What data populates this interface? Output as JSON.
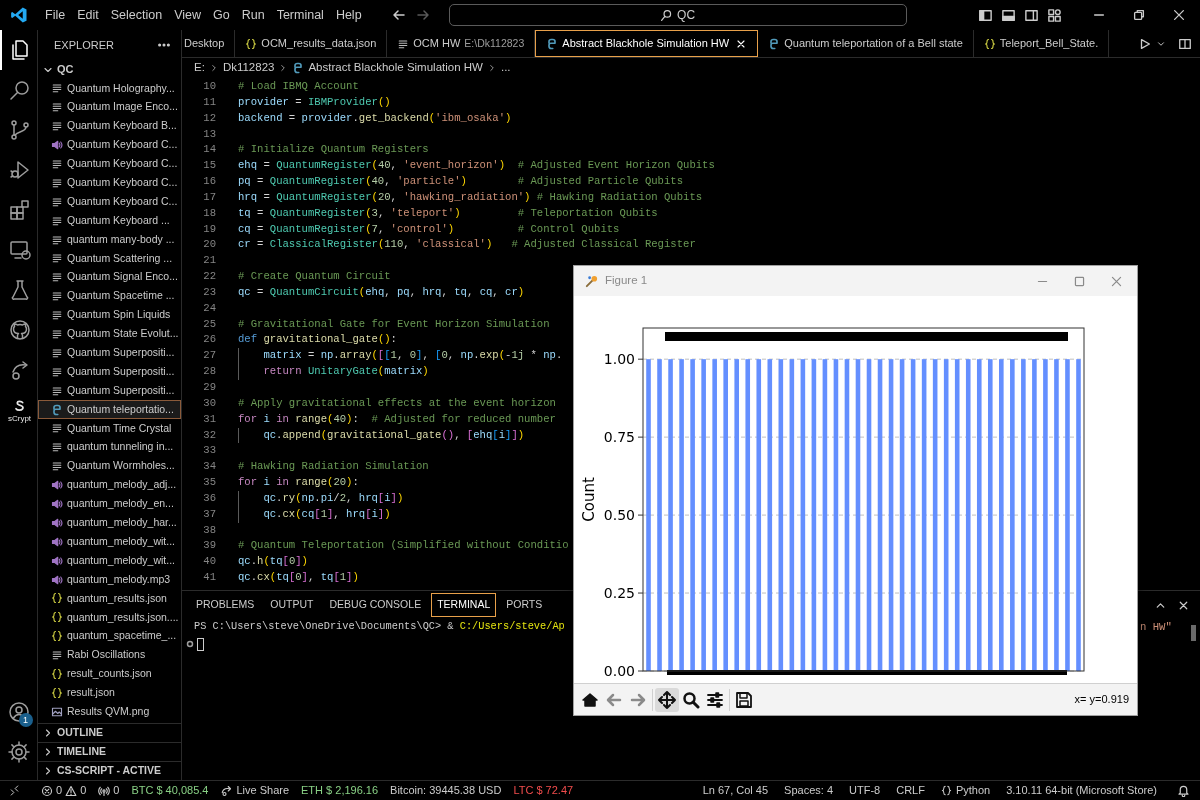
{
  "title_bar": {
    "menu": [
      "File",
      "Edit",
      "Selection",
      "View",
      "Go",
      "Run",
      "Terminal",
      "Help"
    ],
    "nav": [
      {
        "kind": "back",
        "disabled": false
      },
      {
        "kind": "forward",
        "disabled": true
      }
    ],
    "search": {
      "value": "QC"
    }
  },
  "activity_bar": {
    "items": [
      {
        "kind": "files",
        "selected": true
      },
      {
        "kind": "search",
        "selected": false
      },
      {
        "kind": "scm",
        "selected": false
      },
      {
        "kind": "debug",
        "selected": false
      },
      {
        "kind": "extensions",
        "selected": false
      },
      {
        "kind": "remote",
        "selected": false
      },
      {
        "kind": "testing",
        "selected": false
      },
      {
        "kind": "github",
        "selected": false
      },
      {
        "kind": "liveshare",
        "selected": false
      },
      {
        "kind": "scrypt",
        "selected": false,
        "label": "sCrypt"
      }
    ],
    "bottom": [
      {
        "kind": "account",
        "badge": "1"
      },
      {
        "kind": "settings"
      }
    ]
  },
  "explorer": {
    "title": "EXPLORER",
    "folder": {
      "name": "QC",
      "expanded": true
    },
    "items": [
      {
        "name": "Quantum Holography...",
        "kind": "md",
        "selected": false
      },
      {
        "name": "Quantum Image Enco...",
        "kind": "md",
        "selected": false
      },
      {
        "name": "Quantum Keyboard B...",
        "kind": "md",
        "selected": false
      },
      {
        "name": "Quantum Keyboard C...",
        "kind": "audio",
        "selected": false
      },
      {
        "name": "Quantum Keyboard C...",
        "kind": "md",
        "selected": false
      },
      {
        "name": "Quantum Keyboard C...",
        "kind": "md",
        "selected": false
      },
      {
        "name": "Quantum Keyboard C...",
        "kind": "md",
        "selected": false
      },
      {
        "name": "Quantum Keyboard ...",
        "kind": "md",
        "selected": false
      },
      {
        "name": "quantum many-body ...",
        "kind": "md",
        "selected": false
      },
      {
        "name": "Quantum Scattering ...",
        "kind": "md",
        "selected": false
      },
      {
        "name": "Quantum Signal Enco...",
        "kind": "md",
        "selected": false
      },
      {
        "name": "Quantum Spacetime ...",
        "kind": "md",
        "selected": false
      },
      {
        "name": "Quantum Spin Liquids",
        "kind": "md",
        "selected": false
      },
      {
        "name": "Quantum State Evolut...",
        "kind": "md",
        "selected": false
      },
      {
        "name": "Quantum Superpositi...",
        "kind": "md",
        "selected": false
      },
      {
        "name": "Quantum Superpositi...",
        "kind": "md",
        "selected": false
      },
      {
        "name": "Quantum Superpositi...",
        "kind": "md",
        "selected": false
      },
      {
        "name": "Quantum teleportatio...",
        "kind": "py",
        "selected": true
      },
      {
        "name": "Quantum Time Crystal",
        "kind": "md",
        "selected": false
      },
      {
        "name": "quantum tunneling in...",
        "kind": "md",
        "selected": false
      },
      {
        "name": "Quantum Wormholes...",
        "kind": "md",
        "selected": false
      },
      {
        "name": "quantum_melody_adj...",
        "kind": "audio",
        "selected": false
      },
      {
        "name": "quantum_melody_en...",
        "kind": "audio",
        "selected": false
      },
      {
        "name": "quantum_melody_har...",
        "kind": "audio",
        "selected": false
      },
      {
        "name": "quantum_melody_wit...",
        "kind": "audio",
        "selected": false
      },
      {
        "name": "quantum_melody_wit...",
        "kind": "audio",
        "selected": false
      },
      {
        "name": "quantum_melody.mp3",
        "kind": "audio",
        "selected": false
      },
      {
        "name": "quantum_results.json",
        "kind": "json",
        "selected": false
      },
      {
        "name": "quantum_results.json....",
        "kind": "json",
        "selected": false
      },
      {
        "name": "quantum_spacetime_...",
        "kind": "json",
        "selected": false
      },
      {
        "name": "Rabi Oscillations",
        "kind": "md",
        "selected": false
      },
      {
        "name": "result_counts.json",
        "kind": "json",
        "selected": false
      },
      {
        "name": "result.json",
        "kind": "json",
        "selected": false
      },
      {
        "name": "Results QVM.png",
        "kind": "image",
        "selected": false
      }
    ],
    "sections": [
      {
        "name": "OUTLINE",
        "expanded": false
      },
      {
        "name": "TIMELINE",
        "expanded": false
      },
      {
        "name": "CS-SCRIPT - ACTIVE",
        "expanded": false
      }
    ]
  },
  "editor": {
    "tabs": [
      {
        "label": "Desktop",
        "kind": "none",
        "selected": false
      },
      {
        "label": "OCM_results_data.json",
        "kind": "json",
        "selected": false
      },
      {
        "label": "OCM HW",
        "detail": "E:\\Dk112823",
        "kind": "md",
        "selected": false
      },
      {
        "label": "Abstract Blackhole Simulation HW",
        "kind": "py",
        "selected": true
      },
      {
        "label": "Quantum teleportation of a Bell state",
        "kind": "py",
        "selected": false
      },
      {
        "label": "Teleport_Bell_State.",
        "kind": "json",
        "selected": false
      }
    ],
    "breadcrumb": [
      {
        "label": "E:",
        "kind": "none"
      },
      {
        "label": "Dk112823",
        "kind": "none"
      },
      {
        "label": "Abstract Blackhole Simulation HW",
        "kind": "py"
      },
      {
        "label": "...",
        "kind": "none"
      }
    ],
    "lines": [
      {
        "n": "10",
        "tokens": [
          {
            "kind": "c",
            "text": "# Load IBMQ Account"
          }
        ]
      },
      {
        "n": "11",
        "tokens": [
          {
            "kind": "v",
            "text": "provider"
          },
          {
            "kind": "p",
            "text": " = "
          },
          {
            "kind": "t",
            "text": "IBMProvider"
          },
          {
            "kind": "b1",
            "text": "()"
          }
        ]
      },
      {
        "n": "12",
        "tokens": [
          {
            "kind": "v",
            "text": "backend"
          },
          {
            "kind": "p",
            "text": " = "
          },
          {
            "kind": "v",
            "text": "provider"
          },
          {
            "kind": "p",
            "text": "."
          },
          {
            "kind": "f",
            "text": "get_backend"
          },
          {
            "kind": "b1",
            "text": "("
          },
          {
            "kind": "s",
            "text": "'ibm_osaka'"
          },
          {
            "kind": "b1",
            "text": ")"
          }
        ]
      },
      {
        "n": "13"
      },
      {
        "n": "14",
        "tokens": [
          {
            "kind": "c",
            "text": "# Initialize Quantum Registers"
          }
        ]
      },
      {
        "n": "15",
        "tokens": [
          {
            "kind": "v",
            "text": "ehq"
          },
          {
            "kind": "p",
            "text": " = "
          },
          {
            "kind": "t",
            "text": "QuantumRegister"
          },
          {
            "kind": "b1",
            "text": "("
          },
          {
            "kind": "n",
            "text": "40"
          },
          {
            "kind": "p",
            "text": ", "
          },
          {
            "kind": "s",
            "text": "'event_horizon'"
          },
          {
            "kind": "b1",
            "text": ")"
          },
          {
            "kind": "c",
            "text": "  # Adjusted Event Horizon Qubits"
          }
        ]
      },
      {
        "n": "16",
        "tokens": [
          {
            "kind": "v",
            "text": "pq"
          },
          {
            "kind": "p",
            "text": " = "
          },
          {
            "kind": "t",
            "text": "QuantumRegister"
          },
          {
            "kind": "b1",
            "text": "("
          },
          {
            "kind": "n",
            "text": "40"
          },
          {
            "kind": "p",
            "text": ", "
          },
          {
            "kind": "s",
            "text": "'particle'"
          },
          {
            "kind": "b1",
            "text": ")"
          },
          {
            "kind": "c",
            "text": "        # Adjusted Particle Qubits"
          }
        ]
      },
      {
        "n": "17",
        "tokens": [
          {
            "kind": "v",
            "text": "hrq"
          },
          {
            "kind": "p",
            "text": " = "
          },
          {
            "kind": "t",
            "text": "QuantumRegister"
          },
          {
            "kind": "b1",
            "text": "("
          },
          {
            "kind": "n",
            "text": "20"
          },
          {
            "kind": "p",
            "text": ", "
          },
          {
            "kind": "s",
            "text": "'hawking_radiation'"
          },
          {
            "kind": "b1",
            "text": ")"
          },
          {
            "kind": "c",
            "text": " # Hawking Radiation Qubits"
          }
        ]
      },
      {
        "n": "18",
        "tokens": [
          {
            "kind": "v",
            "text": "tq"
          },
          {
            "kind": "p",
            "text": " = "
          },
          {
            "kind": "t",
            "text": "QuantumRegister"
          },
          {
            "kind": "b1",
            "text": "("
          },
          {
            "kind": "n",
            "text": "3"
          },
          {
            "kind": "p",
            "text": ", "
          },
          {
            "kind": "s",
            "text": "'teleport'"
          },
          {
            "kind": "b1",
            "text": ")"
          },
          {
            "kind": "c",
            "text": "         # Teleportation Qubits"
          }
        ]
      },
      {
        "n": "19",
        "tokens": [
          {
            "kind": "v",
            "text": "cq"
          },
          {
            "kind": "p",
            "text": " = "
          },
          {
            "kind": "t",
            "text": "QuantumRegister"
          },
          {
            "kind": "b1",
            "text": "("
          },
          {
            "kind": "n",
            "text": "7"
          },
          {
            "kind": "p",
            "text": ", "
          },
          {
            "kind": "s",
            "text": "'control'"
          },
          {
            "kind": "b1",
            "text": ")"
          },
          {
            "kind": "c",
            "text": "          # Control Qubits"
          }
        ]
      },
      {
        "n": "20",
        "tokens": [
          {
            "kind": "v",
            "text": "cr"
          },
          {
            "kind": "p",
            "text": " = "
          },
          {
            "kind": "t",
            "text": "ClassicalRegister"
          },
          {
            "kind": "b1",
            "text": "("
          },
          {
            "kind": "n",
            "text": "110"
          },
          {
            "kind": "p",
            "text": ", "
          },
          {
            "kind": "s",
            "text": "'classical'"
          },
          {
            "kind": "b1",
            "text": ")"
          },
          {
            "kind": "c",
            "text": "   # Adjusted Classical Register"
          }
        ]
      },
      {
        "n": "21"
      },
      {
        "n": "22",
        "tokens": [
          {
            "kind": "c",
            "text": "# Create Quantum Circuit"
          }
        ]
      },
      {
        "n": "23",
        "tokens": [
          {
            "kind": "v",
            "text": "qc"
          },
          {
            "kind": "p",
            "text": " = "
          },
          {
            "kind": "t",
            "text": "QuantumCircuit"
          },
          {
            "kind": "b1",
            "text": "("
          },
          {
            "kind": "v",
            "text": "ehq"
          },
          {
            "kind": "p",
            "text": ", "
          },
          {
            "kind": "v",
            "text": "pq"
          },
          {
            "kind": "p",
            "text": ", "
          },
          {
            "kind": "v",
            "text": "hrq"
          },
          {
            "kind": "p",
            "text": ", "
          },
          {
            "kind": "v",
            "text": "tq"
          },
          {
            "kind": "p",
            "text": ", "
          },
          {
            "kind": "v",
            "text": "cq"
          },
          {
            "kind": "p",
            "text": ", "
          },
          {
            "kind": "v",
            "text": "cr"
          },
          {
            "kind": "b1",
            "text": ")"
          }
        ]
      },
      {
        "n": "24"
      },
      {
        "n": "25",
        "tokens": [
          {
            "kind": "c",
            "text": "# Gravitational Gate for Event Horizon Simulation"
          }
        ]
      },
      {
        "n": "26",
        "tokens": [
          {
            "kind": "d",
            "text": "def "
          },
          {
            "kind": "f",
            "text": "gravitational_gate"
          },
          {
            "kind": "b1",
            "text": "()"
          },
          {
            "kind": "p",
            "text": ":"
          }
        ]
      },
      {
        "n": "27",
        "indent": true,
        "tokens": [
          {
            "kind": "v",
            "text": "matrix"
          },
          {
            "kind": "p",
            "text": " = "
          },
          {
            "kind": "v",
            "text": "np"
          },
          {
            "kind": "p",
            "text": "."
          },
          {
            "kind": "f",
            "text": "array"
          },
          {
            "kind": "b1",
            "text": "("
          },
          {
            "kind": "b2",
            "text": "["
          },
          {
            "kind": "b3",
            "text": "["
          },
          {
            "kind": "n",
            "text": "1"
          },
          {
            "kind": "p",
            "text": ", "
          },
          {
            "kind": "n",
            "text": "0"
          },
          {
            "kind": "b3",
            "text": "]"
          },
          {
            "kind": "p",
            "text": ", "
          },
          {
            "kind": "b3",
            "text": "["
          },
          {
            "kind": "n",
            "text": "0"
          },
          {
            "kind": "p",
            "text": ", "
          },
          {
            "kind": "v",
            "text": "np"
          },
          {
            "kind": "p",
            "text": "."
          },
          {
            "kind": "f",
            "text": "exp"
          },
          {
            "kind": "b1",
            "text": "("
          },
          {
            "kind": "p",
            "text": "-"
          },
          {
            "kind": "n",
            "text": "1j"
          },
          {
            "kind": "p",
            "text": " * "
          },
          {
            "kind": "v",
            "text": "np"
          },
          {
            "kind": "p",
            "text": "."
          }
        ]
      },
      {
        "n": "28",
        "indent": true,
        "tokens": [
          {
            "kind": "k",
            "text": "return "
          },
          {
            "kind": "t",
            "text": "UnitaryGate"
          },
          {
            "kind": "b1",
            "text": "("
          },
          {
            "kind": "v",
            "text": "matrix"
          },
          {
            "kind": "b1",
            "text": ")"
          }
        ]
      },
      {
        "n": "29"
      },
      {
        "n": "30",
        "tokens": [
          {
            "kind": "c",
            "text": "# Apply gravitational effects at the event horizon"
          }
        ]
      },
      {
        "n": "31",
        "tokens": [
          {
            "kind": "k",
            "text": "for "
          },
          {
            "kind": "v",
            "text": "i "
          },
          {
            "kind": "k",
            "text": "in "
          },
          {
            "kind": "f",
            "text": "range"
          },
          {
            "kind": "b1",
            "text": "("
          },
          {
            "kind": "n",
            "text": "40"
          },
          {
            "kind": "b1",
            "text": ")"
          },
          {
            "kind": "p",
            "text": ":"
          },
          {
            "kind": "c",
            "text": "  # Adjusted for reduced number"
          }
        ]
      },
      {
        "n": "32",
        "indent": true,
        "tokens": [
          {
            "kind": "v",
            "text": "qc"
          },
          {
            "kind": "p",
            "text": "."
          },
          {
            "kind": "f",
            "text": "append"
          },
          {
            "kind": "b1",
            "text": "("
          },
          {
            "kind": "f",
            "text": "gravitational_gate"
          },
          {
            "kind": "b2",
            "text": "()"
          },
          {
            "kind": "p",
            "text": ", "
          },
          {
            "kind": "b2",
            "text": "["
          },
          {
            "kind": "v",
            "text": "ehq"
          },
          {
            "kind": "b3",
            "text": "["
          },
          {
            "kind": "v",
            "text": "i"
          },
          {
            "kind": "b3",
            "text": "]"
          },
          {
            "kind": "b2",
            "text": "]"
          },
          {
            "kind": "b1",
            "text": ")"
          }
        ]
      },
      {
        "n": "33"
      },
      {
        "n": "34",
        "tokens": [
          {
            "kind": "c",
            "text": "# Hawking Radiation Simulation"
          }
        ]
      },
      {
        "n": "35",
        "tokens": [
          {
            "kind": "k",
            "text": "for "
          },
          {
            "kind": "v",
            "text": "i "
          },
          {
            "kind": "k",
            "text": "in "
          },
          {
            "kind": "f",
            "text": "range"
          },
          {
            "kind": "b1",
            "text": "("
          },
          {
            "kind": "n",
            "text": "20"
          },
          {
            "kind": "b1",
            "text": ")"
          },
          {
            "kind": "p",
            "text": ":"
          }
        ]
      },
      {
        "n": "36",
        "indent": true,
        "tokens": [
          {
            "kind": "v",
            "text": "qc"
          },
          {
            "kind": "p",
            "text": "."
          },
          {
            "kind": "f",
            "text": "ry"
          },
          {
            "kind": "b1",
            "text": "("
          },
          {
            "kind": "v",
            "text": "np"
          },
          {
            "kind": "p",
            "text": "."
          },
          {
            "kind": "v",
            "text": "pi"
          },
          {
            "kind": "p",
            "text": "/"
          },
          {
            "kind": "n",
            "text": "2"
          },
          {
            "kind": "p",
            "text": ", "
          },
          {
            "kind": "v",
            "text": "hrq"
          },
          {
            "kind": "b2",
            "text": "["
          },
          {
            "kind": "v",
            "text": "i"
          },
          {
            "kind": "b2",
            "text": "]"
          },
          {
            "kind": "b1",
            "text": ")"
          }
        ]
      },
      {
        "n": "37",
        "indent": true,
        "tokens": [
          {
            "kind": "v",
            "text": "qc"
          },
          {
            "kind": "p",
            "text": "."
          },
          {
            "kind": "f",
            "text": "cx"
          },
          {
            "kind": "b1",
            "text": "("
          },
          {
            "kind": "v",
            "text": "cq"
          },
          {
            "kind": "b2",
            "text": "["
          },
          {
            "kind": "n",
            "text": "1"
          },
          {
            "kind": "b2",
            "text": "]"
          },
          {
            "kind": "p",
            "text": ", "
          },
          {
            "kind": "v",
            "text": "hrq"
          },
          {
            "kind": "b2",
            "text": "["
          },
          {
            "kind": "v",
            "text": "i"
          },
          {
            "kind": "b2",
            "text": "]"
          },
          {
            "kind": "b1",
            "text": ")"
          }
        ]
      },
      {
        "n": "38"
      },
      {
        "n": "39",
        "tokens": [
          {
            "kind": "c",
            "text": "# Quantum Teleportation (Simplified without Conditio"
          }
        ]
      },
      {
        "n": "40",
        "tokens": [
          {
            "kind": "v",
            "text": "qc"
          },
          {
            "kind": "p",
            "text": "."
          },
          {
            "kind": "f",
            "text": "h"
          },
          {
            "kind": "b1",
            "text": "("
          },
          {
            "kind": "v",
            "text": "tq"
          },
          {
            "kind": "b2",
            "text": "["
          },
          {
            "kind": "n",
            "text": "0"
          },
          {
            "kind": "b2",
            "text": "]"
          },
          {
            "kind": "b1",
            "text": ")"
          }
        ]
      },
      {
        "n": "41",
        "tokens": [
          {
            "kind": "v",
            "text": "qc"
          },
          {
            "kind": "p",
            "text": "."
          },
          {
            "kind": "f",
            "text": "cx"
          },
          {
            "kind": "b1",
            "text": "("
          },
          {
            "kind": "v",
            "text": "tq"
          },
          {
            "kind": "b2",
            "text": "["
          },
          {
            "kind": "n",
            "text": "0"
          },
          {
            "kind": "b2",
            "text": "]"
          },
          {
            "kind": "p",
            "text": ", "
          },
          {
            "kind": "v",
            "text": "tq"
          },
          {
            "kind": "b2",
            "text": "["
          },
          {
            "kind": "n",
            "text": "1"
          },
          {
            "kind": "b2",
            "text": "]"
          },
          {
            "kind": "b1",
            "text": ")"
          }
        ]
      }
    ]
  },
  "panel": {
    "tabs": [
      {
        "label": "PROBLEMS",
        "selected": false
      },
      {
        "label": "OUTPUT",
        "selected": false
      },
      {
        "label": "DEBUG CONSOLE",
        "selected": false
      },
      {
        "label": "TERMINAL",
        "selected": true
      },
      {
        "label": "PORTS",
        "selected": false
      }
    ],
    "terminal": {
      "prompt": "PS C:\\Users\\steve\\OneDrive\\Documents\\QC> ",
      "command": "& ",
      "path": "C:/Users/steve/Ap",
      "tail": "n HW\""
    }
  },
  "figure": {
    "title": "Figure 1",
    "chart_data": {
      "type": "bar",
      "ylabel": "Count",
      "grid": true,
      "ylim": [
        0,
        1.1
      ],
      "yticks": [
        {
          "value": 0,
          "label": "0.00"
        },
        {
          "value": 0.25,
          "label": "0.25"
        },
        {
          "value": 0.5,
          "label": "0.50"
        },
        {
          "value": 0.75,
          "label": "0.75"
        },
        {
          "value": 1,
          "label": "1.00"
        }
      ],
      "values": [
        1,
        1,
        1,
        1,
        1,
        1,
        1,
        1,
        1,
        1,
        1,
        1,
        1,
        1,
        1,
        1,
        1,
        1,
        1,
        1,
        1,
        1,
        1,
        1,
        1,
        1,
        1,
        1,
        1,
        1,
        1,
        1,
        1,
        1,
        1,
        1,
        1,
        1,
        1,
        1
      ]
    },
    "toolbar": [
      {
        "kind": "home",
        "selected": false
      },
      {
        "kind": "back",
        "selected": false
      },
      {
        "kind": "forward",
        "selected": false
      },
      {
        "kind": "pan",
        "selected": true
      },
      {
        "kind": "zoom",
        "selected": false
      },
      {
        "kind": "configure",
        "selected": false
      },
      {
        "kind": "save",
        "selected": false
      }
    ],
    "coords": "x= y=0.919"
  },
  "status_bar": {
    "left": [
      {
        "kind": "remote"
      },
      {
        "kind": "problems",
        "errors": "0",
        "warnings": "0"
      },
      {
        "kind": "ports",
        "text": "0"
      },
      {
        "kind": "text",
        "text": "BTC $ 40,085.4",
        "color": "#89d185"
      },
      {
        "kind": "liveshare",
        "text": "Live Share"
      },
      {
        "kind": "text",
        "text": "ETH $ 2,196.16",
        "color": "#89d185"
      },
      {
        "kind": "text",
        "text": "Bitcoin: 39445.38 USD",
        "color": "#cccccc"
      },
      {
        "kind": "text",
        "text": "LTC $ 72.47",
        "color": "#f14c4c"
      }
    ],
    "right": [
      {
        "kind": "text",
        "text": "Ln 67, Col 45"
      },
      {
        "kind": "text",
        "text": "Spaces: 4"
      },
      {
        "kind": "text",
        "text": "UTF-8"
      },
      {
        "kind": "text",
        "text": "CRLF"
      },
      {
        "kind": "language",
        "text": "Python"
      },
      {
        "kind": "text",
        "text": "3.10.11 64-bit (Microsoft Store)"
      },
      {
        "kind": "bell"
      }
    ]
  }
}
